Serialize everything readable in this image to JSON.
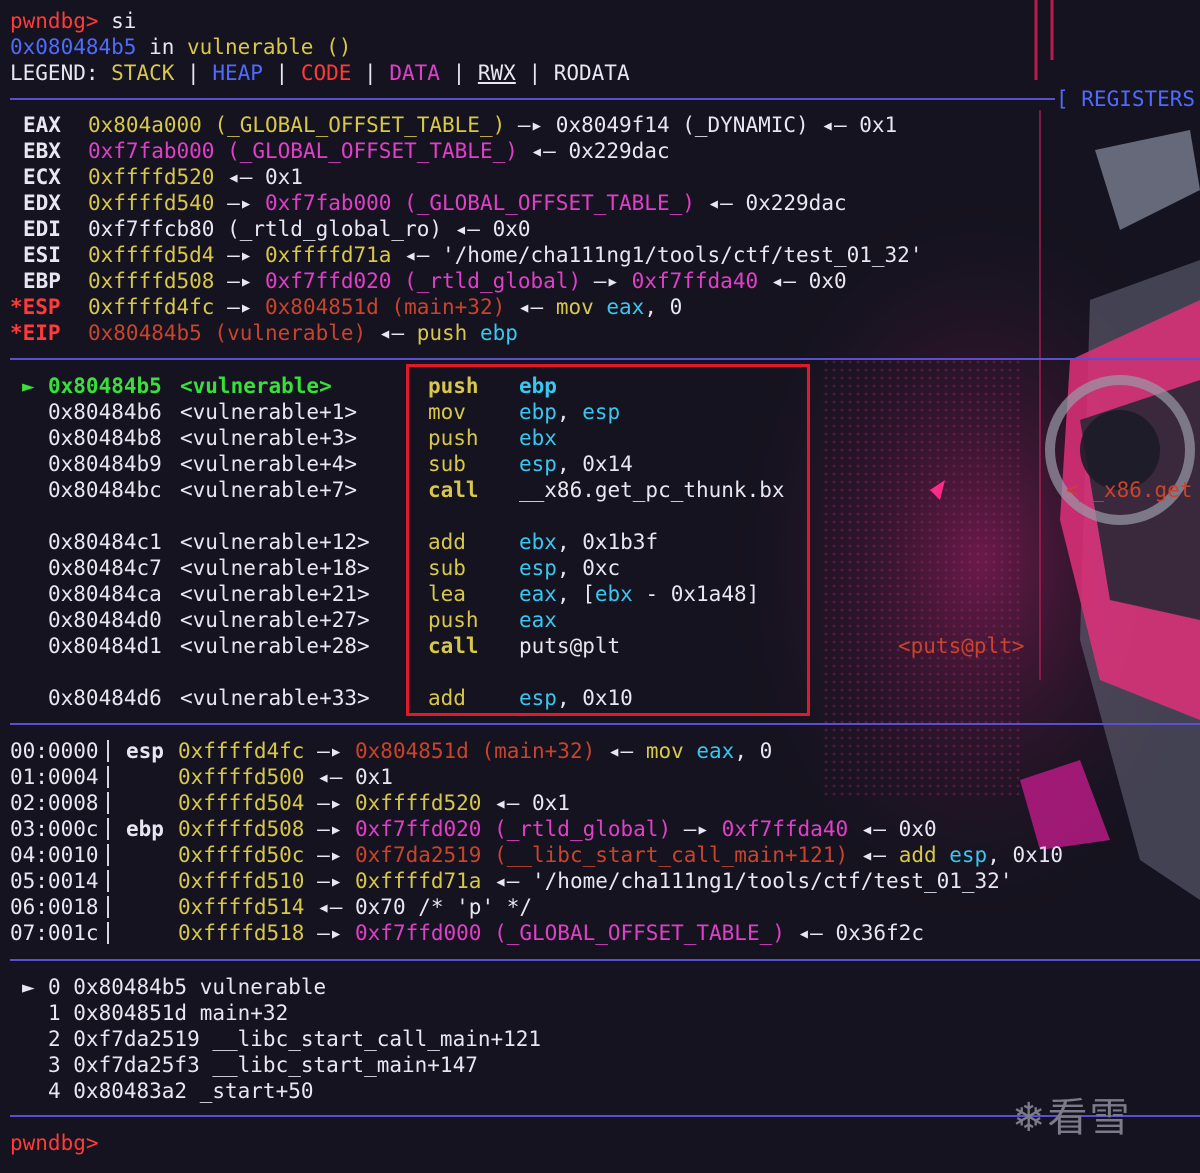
{
  "prompt": {
    "label": "pwndbg>",
    "command": " si"
  },
  "location": {
    "addr": "0x080484b5",
    "in": " in ",
    "func": "vulnerable ()"
  },
  "legend": {
    "label": "LEGEND: ",
    "stack": "STACK",
    "heap": "HEAP",
    "code": "CODE",
    "data": "DATA",
    "rwx": "RWX",
    "rodata": "RODATA",
    "sep": " | "
  },
  "sections": {
    "registers": "[ REGISTERS"
  },
  "registers": [
    {
      "name": "EAX",
      "parts": [
        [
          "yellow",
          "0x804a000"
        ],
        [
          "yellow",
          " (_GLOBAL_OFFSET_TABLE_)"
        ],
        [
          "white",
          " —▸ 0x8049f14 (_DYNAMIC) ◂— 0x1"
        ]
      ]
    },
    {
      "name": "EBX",
      "parts": [
        [
          "mag",
          "0xf7fab000"
        ],
        [
          "mag",
          " (_GLOBAL_OFFSET_TABLE_)"
        ],
        [
          "white",
          " ◂— 0x229dac"
        ]
      ]
    },
    {
      "name": "ECX",
      "parts": [
        [
          "yellow",
          "0xffffd520"
        ],
        [
          "white",
          " ◂— 0x1"
        ]
      ]
    },
    {
      "name": "EDX",
      "parts": [
        [
          "yellow",
          "0xffffd540"
        ],
        [
          "white",
          " —▸ "
        ],
        [
          "mag",
          "0xf7fab000 (_GLOBAL_OFFSET_TABLE_)"
        ],
        [
          "white",
          " ◂— 0x229dac"
        ]
      ]
    },
    {
      "name": "EDI",
      "parts": [
        [
          "white",
          "0xf7ffcb80 (_rtld_global_ro) ◂— 0x0"
        ]
      ]
    },
    {
      "name": "ESI",
      "parts": [
        [
          "yellow",
          "0xffffd5d4"
        ],
        [
          "white",
          " —▸ "
        ],
        [
          "yellow",
          "0xffffd71a"
        ],
        [
          "white",
          " ◂— '/home/cha111ng1/tools/ctf/test_01_32'"
        ]
      ]
    },
    {
      "name": "EBP",
      "parts": [
        [
          "yellow",
          "0xffffd508"
        ],
        [
          "white",
          " —▸ "
        ],
        [
          "mag",
          "0xf7ffd020 (_rtld_global)"
        ],
        [
          "white",
          " —▸ "
        ],
        [
          "mag",
          "0xf7ffda40"
        ],
        [
          "white",
          " ◂— 0x0"
        ]
      ]
    },
    {
      "name": "*ESP",
      "changed": true,
      "parts": [
        [
          "yellow",
          "0xffffd4fc"
        ],
        [
          "white",
          " —▸ "
        ],
        [
          "dim-red",
          "0x804851d (main+32)"
        ],
        [
          "white",
          " ◂— "
        ],
        [
          "yellow",
          "mov "
        ],
        [
          "cyan",
          "eax"
        ],
        [
          "white",
          ", 0"
        ]
      ]
    },
    {
      "name": "*EIP",
      "changed": true,
      "parts": [
        [
          "dim-red",
          "0x80484b5 (vulnerable)"
        ],
        [
          "white",
          " ◂— "
        ],
        [
          "yellow",
          "push "
        ],
        [
          "cyan",
          "ebp"
        ]
      ]
    }
  ],
  "disasm": [
    {
      "marker": "►",
      "addr": "0x80484b5",
      "sym": "<vulnerable>",
      "mn": "push",
      "ops": [
        [
          "cyan",
          "ebp"
        ]
      ],
      "current": true
    },
    {
      "addr": "0x80484b6",
      "sym": "<vulnerable+1>",
      "mn": "mov",
      "ops": [
        [
          "cyan",
          "ebp"
        ],
        [
          "white",
          ", "
        ],
        [
          "cyan",
          "esp"
        ]
      ]
    },
    {
      "addr": "0x80484b8",
      "sym": "<vulnerable+3>",
      "mn": "push",
      "ops": [
        [
          "cyan",
          "ebx"
        ]
      ]
    },
    {
      "addr": "0x80484b9",
      "sym": "<vulnerable+4>",
      "mn": "sub",
      "ops": [
        [
          "cyan",
          "esp"
        ],
        [
          "white",
          ", 0x14"
        ]
      ]
    },
    {
      "addr": "0x80484bc",
      "sym": "<vulnerable+7>",
      "mn": "call",
      "ops": [
        [
          "white",
          "__x86.get_pc_thunk.bx"
        ]
      ],
      "bold": true,
      "ghost": "<__x86.get"
    },
    {
      "gap": true
    },
    {
      "addr": "0x80484c1",
      "sym": "<vulnerable+12>",
      "mn": "add",
      "ops": [
        [
          "cyan",
          "ebx"
        ],
        [
          "white",
          ", 0x1b3f"
        ]
      ]
    },
    {
      "addr": "0x80484c7",
      "sym": "<vulnerable+18>",
      "mn": "sub",
      "ops": [
        [
          "cyan",
          "esp"
        ],
        [
          "white",
          ", 0xc"
        ]
      ]
    },
    {
      "addr": "0x80484ca",
      "sym": "<vulnerable+21>",
      "mn": "lea",
      "ops": [
        [
          "cyan",
          "eax"
        ],
        [
          "white",
          ", ["
        ],
        [
          "cyan",
          "ebx"
        ],
        [
          "white",
          " - 0x1a48]"
        ]
      ]
    },
    {
      "addr": "0x80484d0",
      "sym": "<vulnerable+27>",
      "mn": "push",
      "ops": [
        [
          "cyan",
          "eax"
        ]
      ]
    },
    {
      "addr": "0x80484d1",
      "sym": "<vulnerable+28>",
      "mn": "call",
      "ops": [
        [
          "white",
          "puts@plt"
        ]
      ],
      "bold": true,
      "ghost": "<puts@plt>"
    },
    {
      "gap": true
    },
    {
      "addr": "0x80484d6",
      "sym": "<vulnerable+33>",
      "mn": "add",
      "ops": [
        [
          "cyan",
          "esp"
        ],
        [
          "white",
          ", 0x10"
        ]
      ]
    }
  ],
  "stack": [
    {
      "idx": "00:0000",
      "reg": "esp",
      "parts": [
        [
          "yellow",
          "0xffffd4fc"
        ],
        [
          "white",
          " —▸ "
        ],
        [
          "dim-red",
          "0x804851d (main+32)"
        ],
        [
          "white",
          " ◂— "
        ],
        [
          "yellow",
          "mov "
        ],
        [
          "cyan",
          "eax"
        ],
        [
          "white",
          ", 0"
        ]
      ]
    },
    {
      "idx": "01:0004",
      "reg": "",
      "parts": [
        [
          "yellow",
          "0xffffd500"
        ],
        [
          "white",
          " ◂— 0x1"
        ]
      ]
    },
    {
      "idx": "02:0008",
      "reg": "",
      "parts": [
        [
          "yellow",
          "0xffffd504"
        ],
        [
          "white",
          " —▸ "
        ],
        [
          "yellow",
          "0xffffd520"
        ],
        [
          "white",
          " ◂— 0x1"
        ]
      ]
    },
    {
      "idx": "03:000c",
      "reg": "ebp",
      "parts": [
        [
          "yellow",
          "0xffffd508"
        ],
        [
          "white",
          " —▸ "
        ],
        [
          "mag",
          "0xf7ffd020 (_rtld_global)"
        ],
        [
          "white",
          " —▸ "
        ],
        [
          "mag",
          "0xf7ffda40"
        ],
        [
          "white",
          " ◂— 0x0"
        ]
      ]
    },
    {
      "idx": "04:0010",
      "reg": "",
      "parts": [
        [
          "yellow",
          "0xffffd50c"
        ],
        [
          "white",
          " —▸ "
        ],
        [
          "dim-red",
          "0xf7da2519 (__libc_start_call_main+121)"
        ],
        [
          "white",
          " ◂— "
        ],
        [
          "yellow",
          "add "
        ],
        [
          "cyan",
          "esp"
        ],
        [
          "white",
          ", 0x10"
        ]
      ]
    },
    {
      "idx": "05:0014",
      "reg": "",
      "parts": [
        [
          "yellow",
          "0xffffd510"
        ],
        [
          "white",
          " —▸ "
        ],
        [
          "yellow",
          "0xffffd71a"
        ],
        [
          "white",
          " ◂— '/home/cha111ng1/tools/ctf/test_01_32'"
        ]
      ]
    },
    {
      "idx": "06:0018",
      "reg": "",
      "parts": [
        [
          "yellow",
          "0xffffd514"
        ],
        [
          "white",
          " ◂— 0x70 /* 'p' */"
        ]
      ]
    },
    {
      "idx": "07:001c",
      "reg": "",
      "parts": [
        [
          "yellow",
          "0xffffd518"
        ],
        [
          "white",
          " —▸ "
        ],
        [
          "mag",
          "0xf7ffd000 (_GLOBAL_OFFSET_TABLE_)"
        ],
        [
          "white",
          " ◂— 0x36f2c"
        ]
      ]
    }
  ],
  "backtrace": [
    {
      "marker": "►",
      "text": "0 0x80484b5 vulnerable"
    },
    {
      "text": "1 0x804851d main+32"
    },
    {
      "text": "2 0xf7da2519 __libc_start_call_main+121"
    },
    {
      "text": "3 0xf7da25f3 __libc_start_main+147"
    },
    {
      "text": "4 0x80483a2 _start+50"
    }
  ],
  "watermark": "❄看雪",
  "colors": {
    "accent": "#5a4fd0",
    "prompt": "#ff3a3a",
    "highlight_box": "#e01a2b"
  }
}
